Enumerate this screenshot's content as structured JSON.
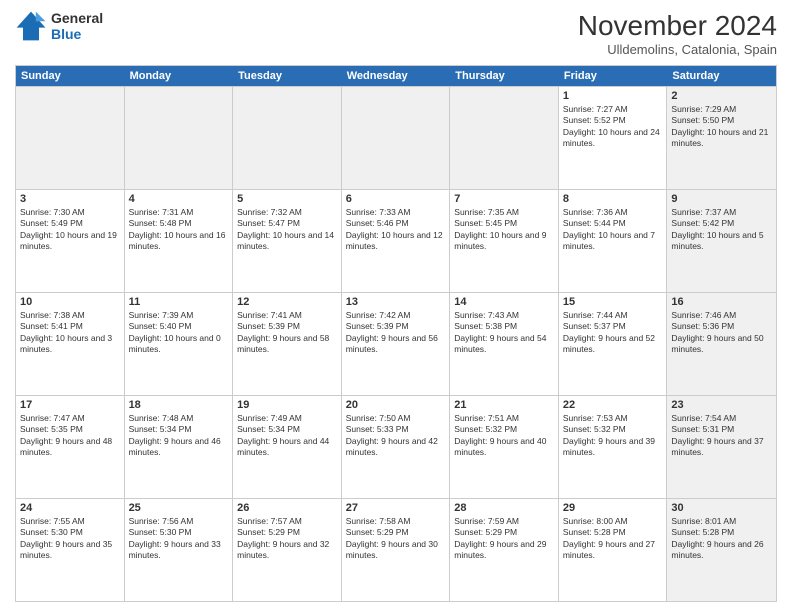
{
  "logo": {
    "line1": "General",
    "line2": "Blue"
  },
  "title": "November 2024",
  "location": "Ulldemolins, Catalonia, Spain",
  "header_days": [
    "Sunday",
    "Monday",
    "Tuesday",
    "Wednesday",
    "Thursday",
    "Friday",
    "Saturday"
  ],
  "weeks": [
    [
      {
        "day": "",
        "text": "",
        "shaded": true
      },
      {
        "day": "",
        "text": "",
        "shaded": true
      },
      {
        "day": "",
        "text": "",
        "shaded": true
      },
      {
        "day": "",
        "text": "",
        "shaded": true
      },
      {
        "day": "",
        "text": "",
        "shaded": true
      },
      {
        "day": "1",
        "text": "Sunrise: 7:27 AM\nSunset: 5:52 PM\nDaylight: 10 hours and 24 minutes.",
        "shaded": false
      },
      {
        "day": "2",
        "text": "Sunrise: 7:29 AM\nSunset: 5:50 PM\nDaylight: 10 hours and 21 minutes.",
        "shaded": true
      }
    ],
    [
      {
        "day": "3",
        "text": "Sunrise: 7:30 AM\nSunset: 5:49 PM\nDaylight: 10 hours and 19 minutes.",
        "shaded": false
      },
      {
        "day": "4",
        "text": "Sunrise: 7:31 AM\nSunset: 5:48 PM\nDaylight: 10 hours and 16 minutes.",
        "shaded": false
      },
      {
        "day": "5",
        "text": "Sunrise: 7:32 AM\nSunset: 5:47 PM\nDaylight: 10 hours and 14 minutes.",
        "shaded": false
      },
      {
        "day": "6",
        "text": "Sunrise: 7:33 AM\nSunset: 5:46 PM\nDaylight: 10 hours and 12 minutes.",
        "shaded": false
      },
      {
        "day": "7",
        "text": "Sunrise: 7:35 AM\nSunset: 5:45 PM\nDaylight: 10 hours and 9 minutes.",
        "shaded": false
      },
      {
        "day": "8",
        "text": "Sunrise: 7:36 AM\nSunset: 5:44 PM\nDaylight: 10 hours and 7 minutes.",
        "shaded": false
      },
      {
        "day": "9",
        "text": "Sunrise: 7:37 AM\nSunset: 5:42 PM\nDaylight: 10 hours and 5 minutes.",
        "shaded": true
      }
    ],
    [
      {
        "day": "10",
        "text": "Sunrise: 7:38 AM\nSunset: 5:41 PM\nDaylight: 10 hours and 3 minutes.",
        "shaded": false
      },
      {
        "day": "11",
        "text": "Sunrise: 7:39 AM\nSunset: 5:40 PM\nDaylight: 10 hours and 0 minutes.",
        "shaded": false
      },
      {
        "day": "12",
        "text": "Sunrise: 7:41 AM\nSunset: 5:39 PM\nDaylight: 9 hours and 58 minutes.",
        "shaded": false
      },
      {
        "day": "13",
        "text": "Sunrise: 7:42 AM\nSunset: 5:39 PM\nDaylight: 9 hours and 56 minutes.",
        "shaded": false
      },
      {
        "day": "14",
        "text": "Sunrise: 7:43 AM\nSunset: 5:38 PM\nDaylight: 9 hours and 54 minutes.",
        "shaded": false
      },
      {
        "day": "15",
        "text": "Sunrise: 7:44 AM\nSunset: 5:37 PM\nDaylight: 9 hours and 52 minutes.",
        "shaded": false
      },
      {
        "day": "16",
        "text": "Sunrise: 7:46 AM\nSunset: 5:36 PM\nDaylight: 9 hours and 50 minutes.",
        "shaded": true
      }
    ],
    [
      {
        "day": "17",
        "text": "Sunrise: 7:47 AM\nSunset: 5:35 PM\nDaylight: 9 hours and 48 minutes.",
        "shaded": false
      },
      {
        "day": "18",
        "text": "Sunrise: 7:48 AM\nSunset: 5:34 PM\nDaylight: 9 hours and 46 minutes.",
        "shaded": false
      },
      {
        "day": "19",
        "text": "Sunrise: 7:49 AM\nSunset: 5:34 PM\nDaylight: 9 hours and 44 minutes.",
        "shaded": false
      },
      {
        "day": "20",
        "text": "Sunrise: 7:50 AM\nSunset: 5:33 PM\nDaylight: 9 hours and 42 minutes.",
        "shaded": false
      },
      {
        "day": "21",
        "text": "Sunrise: 7:51 AM\nSunset: 5:32 PM\nDaylight: 9 hours and 40 minutes.",
        "shaded": false
      },
      {
        "day": "22",
        "text": "Sunrise: 7:53 AM\nSunset: 5:32 PM\nDaylight: 9 hours and 39 minutes.",
        "shaded": false
      },
      {
        "day": "23",
        "text": "Sunrise: 7:54 AM\nSunset: 5:31 PM\nDaylight: 9 hours and 37 minutes.",
        "shaded": true
      }
    ],
    [
      {
        "day": "24",
        "text": "Sunrise: 7:55 AM\nSunset: 5:30 PM\nDaylight: 9 hours and 35 minutes.",
        "shaded": false
      },
      {
        "day": "25",
        "text": "Sunrise: 7:56 AM\nSunset: 5:30 PM\nDaylight: 9 hours and 33 minutes.",
        "shaded": false
      },
      {
        "day": "26",
        "text": "Sunrise: 7:57 AM\nSunset: 5:29 PM\nDaylight: 9 hours and 32 minutes.",
        "shaded": false
      },
      {
        "day": "27",
        "text": "Sunrise: 7:58 AM\nSunset: 5:29 PM\nDaylight: 9 hours and 30 minutes.",
        "shaded": false
      },
      {
        "day": "28",
        "text": "Sunrise: 7:59 AM\nSunset: 5:29 PM\nDaylight: 9 hours and 29 minutes.",
        "shaded": false
      },
      {
        "day": "29",
        "text": "Sunrise: 8:00 AM\nSunset: 5:28 PM\nDaylight: 9 hours and 27 minutes.",
        "shaded": false
      },
      {
        "day": "30",
        "text": "Sunrise: 8:01 AM\nSunset: 5:28 PM\nDaylight: 9 hours and 26 minutes.",
        "shaded": true
      }
    ]
  ]
}
